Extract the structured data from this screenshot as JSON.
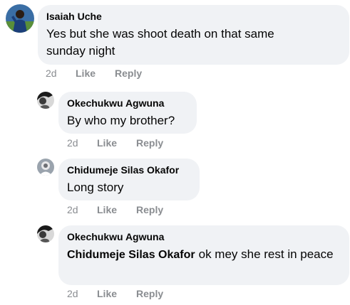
{
  "comments": [
    {
      "author": "Isaiah Uche",
      "text": "Yes but she was shoot death on that same sunday night",
      "time": "2d",
      "like": "Like",
      "reply": "Reply"
    },
    {
      "author": "Okechukwu Agwuna",
      "text": "By who my brother?",
      "time": "2d",
      "like": "Like",
      "reply": "Reply"
    },
    {
      "author": "Chidumeje Silas Okafor",
      "text": "Long story",
      "time": "2d",
      "like": "Like",
      "reply": "Reply"
    },
    {
      "author": "Okechukwu Agwuna",
      "mention": "Chidumeje Silas Okafor",
      "text": "ok mey she rest in peace",
      "time": "2d",
      "like": "Like",
      "reply": "Reply"
    }
  ],
  "colors": {
    "bubble": "#f0f2f5",
    "text": "#050505",
    "meta": "#8a8d91"
  }
}
